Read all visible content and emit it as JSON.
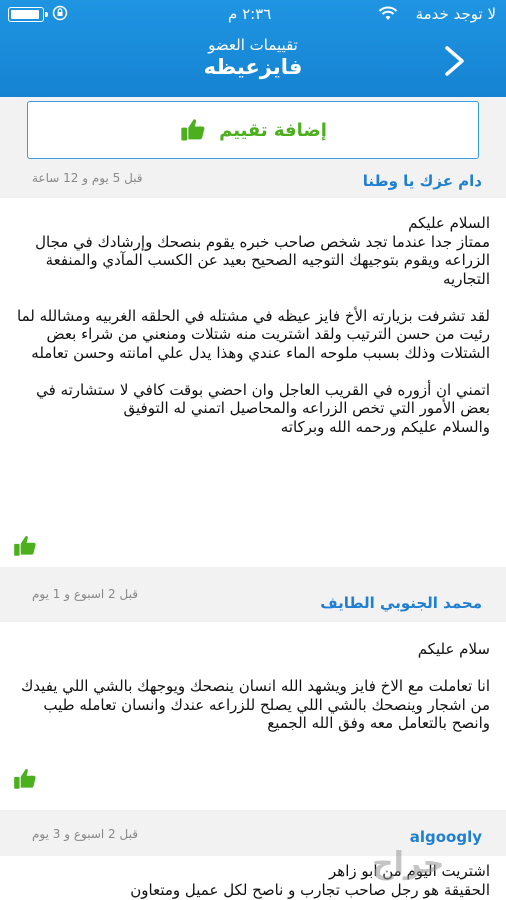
{
  "status_bar": {
    "carrier": "لا توجد خدمة",
    "time": "٢:٣٦ م"
  },
  "nav": {
    "subtitle": "تقييمات العضو",
    "title": "فايزعيظه"
  },
  "add_review_label": "إضافة تقييم",
  "colors": {
    "header": "#1a8ad9",
    "accent_green": "#4caf1e",
    "author_blue": "#1f7fd1"
  },
  "reviews": [
    {
      "author": "دام عزك يا وطنا",
      "time": "قبل 5 يوم و 12 ساعة",
      "body": "السلام عليكم\nممتاز جدا عندما تجد شخص صاحب خبره يقوم بنصحك وإرشادك في مجال الزراعه  ويقوم بتوجيهك التوجيه الصحيح بعيد عن الكسب المآدي والمنفعة  التجاريه\n\nلقد تشرفت بزيارته الأخ فايز عيظه  في مشتله  في الحلقه الغربيه ومشالله لما رئيت من حسن  الترتيب  ولقد اشتريت منه شتلات ومنعني من شراء بعض الشتلات وذلك بسبب ملوحه الماء عندي وهذا يدل علي امانته وحسن تعامله\n\nاتمني ان أزوره في القريب العاجل وان  احضي بوقت كافي  لا ستشارته  في بعض الأمور التي تخص الزراعه والمحاصيل  اتمني له التوفيق\nوالسلام عليكم ورحمه الله وبركاته"
    },
    {
      "author": "محمد الجنوبي الطايف",
      "time": "قبل 2 اسبوع و 1 يوم",
      "body": "سلام عليكم\n\nانا تعاملت مع الاخ فايز ويشهد الله انسان ينصحك ويوجهك بالشي اللي يفيدك من اشجار وينصحك بالشي اللي يصلح للزراعه عندك وانسان تعامله طيب وانصح بالتعامل معه وفق الله الجميع"
    },
    {
      "author": "algoogly",
      "time": "قبل 2 اسبوع و 3 يوم",
      "body": "اشتريت اليوم من ابو زاهر\nالحقيقة هو رجل صاحب تجارب و ناصح لكل عميل ومتعاون"
    }
  ],
  "watermark": "حراج"
}
